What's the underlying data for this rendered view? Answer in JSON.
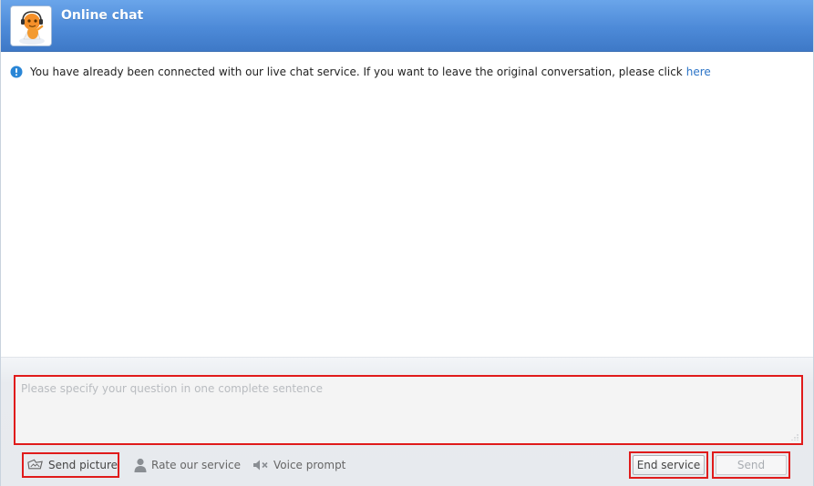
{
  "header": {
    "title": "Online chat",
    "avatar_icon": "support-agent-mascot-icon"
  },
  "notice": {
    "icon": "info-icon",
    "text": "You have already been connected with our live chat service. If you want to leave the original conversation, please click",
    "link_label": "here"
  },
  "composer": {
    "placeholder": "Please specify your question in one complete sentence",
    "value": ""
  },
  "toolbar": {
    "send_picture": {
      "label": "Send picture",
      "icon": "picture-icon"
    },
    "rate_service": {
      "label": "Rate our service",
      "icon": "person-icon"
    },
    "voice_prompt": {
      "label": "Voice prompt",
      "icon": "speaker-muted-icon"
    },
    "end_service_label": "End service",
    "send_label": "Send"
  },
  "colors": {
    "header_blue": "#4d8ad8",
    "highlight_red": "#e01b1b",
    "link_blue": "#2b74c7",
    "info_blue": "#2a86d6"
  }
}
